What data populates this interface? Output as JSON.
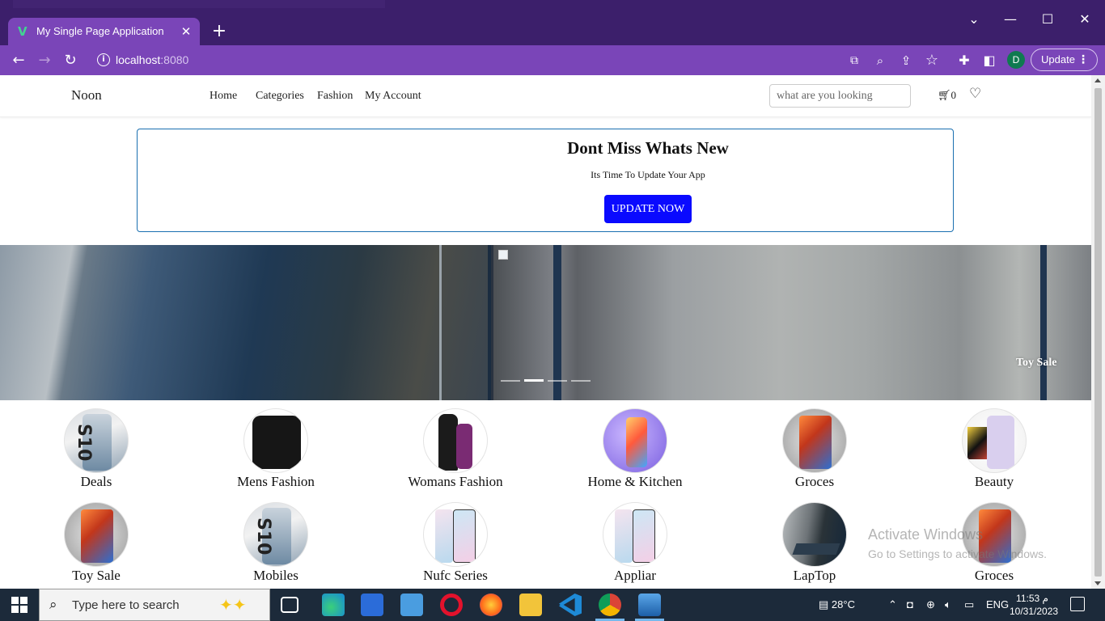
{
  "browser": {
    "tab_title": "My Single Page Application",
    "tab_favicon": "vue-logo-icon",
    "url_host": "localhost",
    "url_port": ":8080",
    "profile_initial": "D",
    "update_label": "Update"
  },
  "nav": {
    "brand": "Noon",
    "links": [
      "Home",
      "Categories",
      "Fashion",
      "My Account"
    ],
    "search_placeholder": "what are you looking",
    "cart_count": "0"
  },
  "promo": {
    "title": "Dont Miss Whats New",
    "subtitle": "Its Time To Update Your App",
    "button": "UPDATE NOW",
    "button_color": "#0a0aff"
  },
  "carousel": {
    "caption": "Toy Sale",
    "slide_count": 4,
    "active_index": 1
  },
  "categories": [
    "Deals",
    "Mens Fashion",
    "Womans Fashion",
    "Home & Kitchen",
    "Groces",
    "Beauty",
    "Toy Sale",
    "Mobiles",
    "Nufc Series",
    "Appliar",
    "LapTop",
    "Groces"
  ],
  "watermark": {
    "line1": "Activate Windows",
    "line2": "Go to Settings to activate Windows."
  },
  "taskbar": {
    "search_placeholder": "Type here to search",
    "weather": "28°C",
    "language": "ENG",
    "time": "11:53 م",
    "date": "10/31/2023"
  }
}
